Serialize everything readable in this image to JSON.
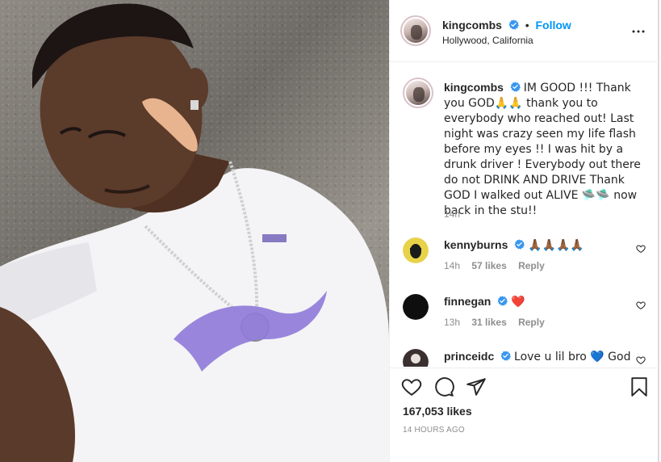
{
  "header": {
    "username": "kingcombs",
    "follow_label": "Follow",
    "separator": "•",
    "location": "Hollywood, California"
  },
  "caption": {
    "username": "kingcombs",
    "text": "IM GOOD !!! Thank you GOD🙏🙏 thank you to everybody who reached out! Last night was crazy seen my life flash before my eyes !! I was hit by a drunk driver ! Everybody out there do not DRINK AND DRIVE Thank GOD I walked out ALIVE 🛸🛸 now back in the stu!!",
    "time": "14h"
  },
  "comments": [
    {
      "username": "kennyburns",
      "text": "🙏🏾🙏🏾🙏🏾🙏🏾",
      "time": "14h",
      "likes": "57 likes",
      "reply": "Reply"
    },
    {
      "username": "finnegan",
      "text": "❤️",
      "time": "13h",
      "likes": "31 likes",
      "reply": "Reply"
    },
    {
      "username": "princeidc",
      "text": "Love u lil bro 💙 God",
      "time": "",
      "likes": "",
      "reply": ""
    }
  ],
  "stats": {
    "likes": "167,053 likes",
    "time_ago": "14 HOURS AGO"
  },
  "icons": {
    "verified": "verified-badge-icon",
    "more": "more-options-icon",
    "like": "heart-icon",
    "comment": "comment-icon",
    "share": "share-icon",
    "save": "bookmark-icon"
  },
  "colors": {
    "accent": "#0095f6",
    "verified": "#3897f0",
    "text": "#262626",
    "muted": "#8e8e8e",
    "heart_red": "#ed4956"
  }
}
